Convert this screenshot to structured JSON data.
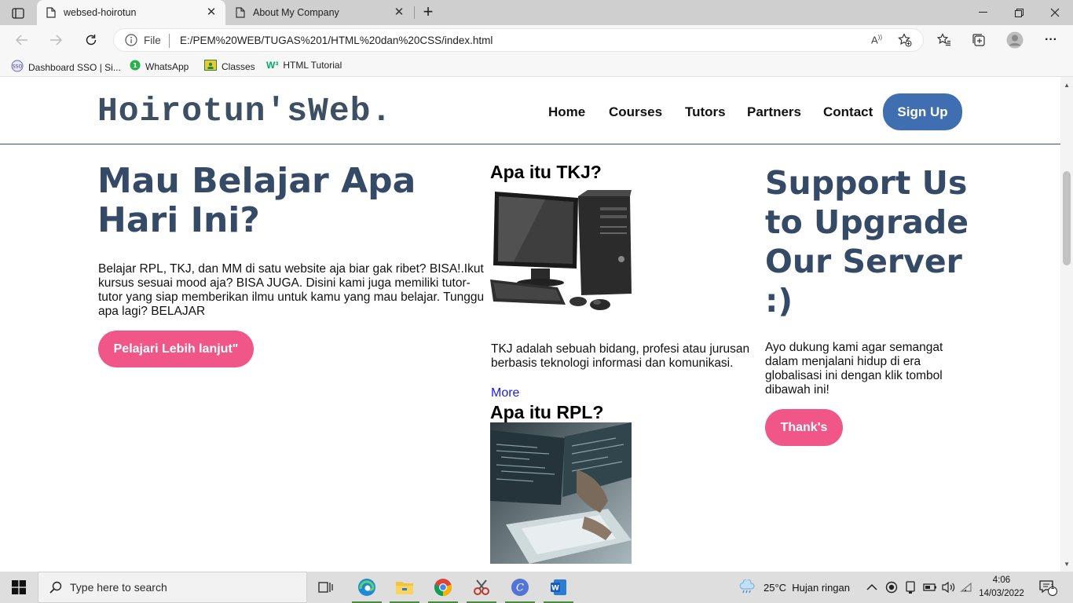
{
  "browser": {
    "tabs": [
      {
        "title": "websed-hoirotun",
        "active": true
      },
      {
        "title": "About My Company",
        "active": false
      }
    ],
    "address": {
      "scheme_label": "File",
      "url": "E:/PEM%20WEB/TUGAS%201/HTML%20dan%20CSS/index.html"
    },
    "bookmarks": [
      {
        "label": "Dashboard SSO | Si...",
        "icon": "sso-icon"
      },
      {
        "label": "WhatsApp",
        "icon": "whatsapp-icon"
      },
      {
        "label": "Classes",
        "icon": "classroom-icon"
      },
      {
        "label": "HTML Tutorial",
        "icon": "w3schools-icon"
      }
    ]
  },
  "page": {
    "brand": "Hoirotun'sWeb.",
    "nav": [
      "Home",
      "Courses",
      "Tutors",
      "Partners",
      "Contact"
    ],
    "signup": "Sign Up",
    "hero": {
      "title": "Mau Belajar Apa Hari Ini?",
      "text": "Belajar RPL, TKJ, dan MM di satu website aja biar gak ribet? BISA!.Ikut kursus sesuai mood aja? BISA JUGA. Disini kami juga memiliki tutor-tutor yang siap memberikan ilmu untuk kamu yang mau belajar. Tunggu apa lagi? BELAJAR",
      "button": "Pelajari Lebih lanjut\""
    },
    "tkj": {
      "title": "Apa itu TKJ?",
      "text": "TKJ adalah sebuah bidang, profesi atau jurusan berbasis teknologi informasi dan komunikasi.",
      "more": "More"
    },
    "rpl": {
      "title": "Apa itu RPL?"
    },
    "support": {
      "title": "Support Us to Upgrade Our Server :)",
      "text": "Ayo dukung kami agar semangat dalam menjalani hidup di era globalisasi ini dengan klik tombol dibawah ini!",
      "button": "Thank's"
    },
    "colors": {
      "heading": "#344a66",
      "pink_button": "#f05788",
      "signup_button": "#3f6fb0"
    }
  },
  "taskbar": {
    "search_placeholder": "Type here to search",
    "weather": "25°C  Hujan ringan",
    "time": "4:06",
    "date": "14/03/2022",
    "notification_count": "1"
  }
}
